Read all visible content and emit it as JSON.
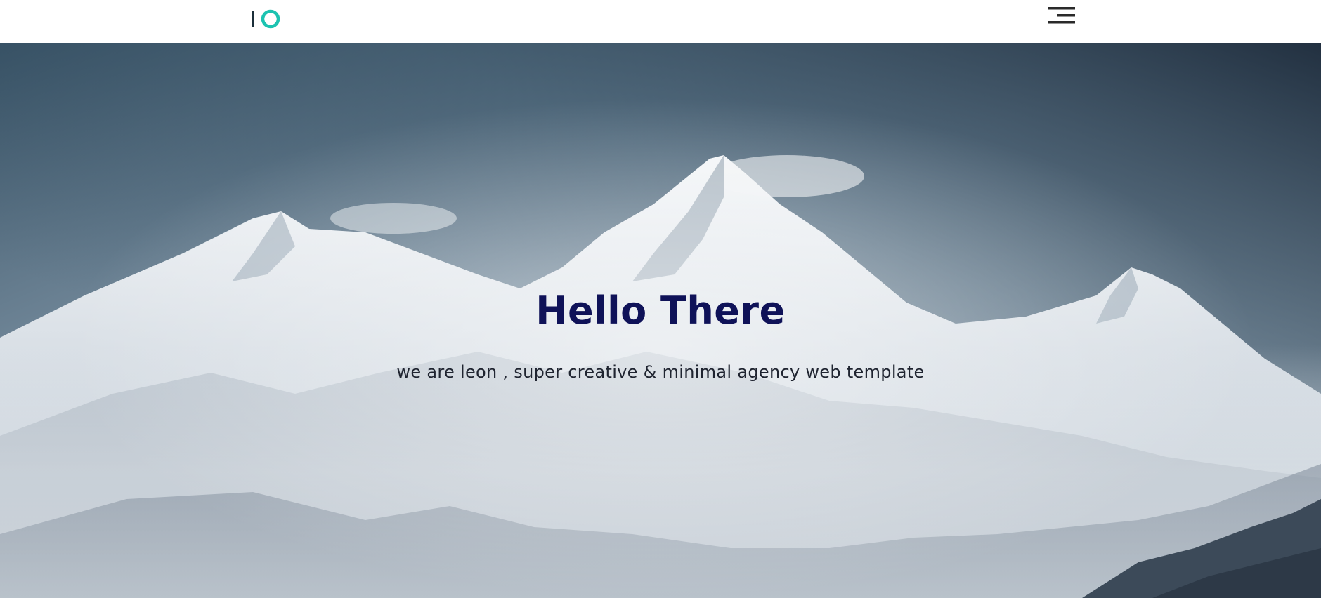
{
  "header": {
    "logo_icon": "io-logo-icon",
    "menu_icon": "hamburger-menu-icon",
    "colors": {
      "logo_bar": "#1b2f3a",
      "logo_ring": "#1cc3b1",
      "menu_lines": "#2a2a2a"
    }
  },
  "hero": {
    "title": "Hello There",
    "subtitle": "we are leon , super creative & minimal agency web template",
    "background": "mountain-landscape-image",
    "colors": {
      "title": "#0f1258",
      "subtitle": "#1f2430",
      "sky_top": "#2c4459",
      "mist": "#d8dde3"
    }
  }
}
